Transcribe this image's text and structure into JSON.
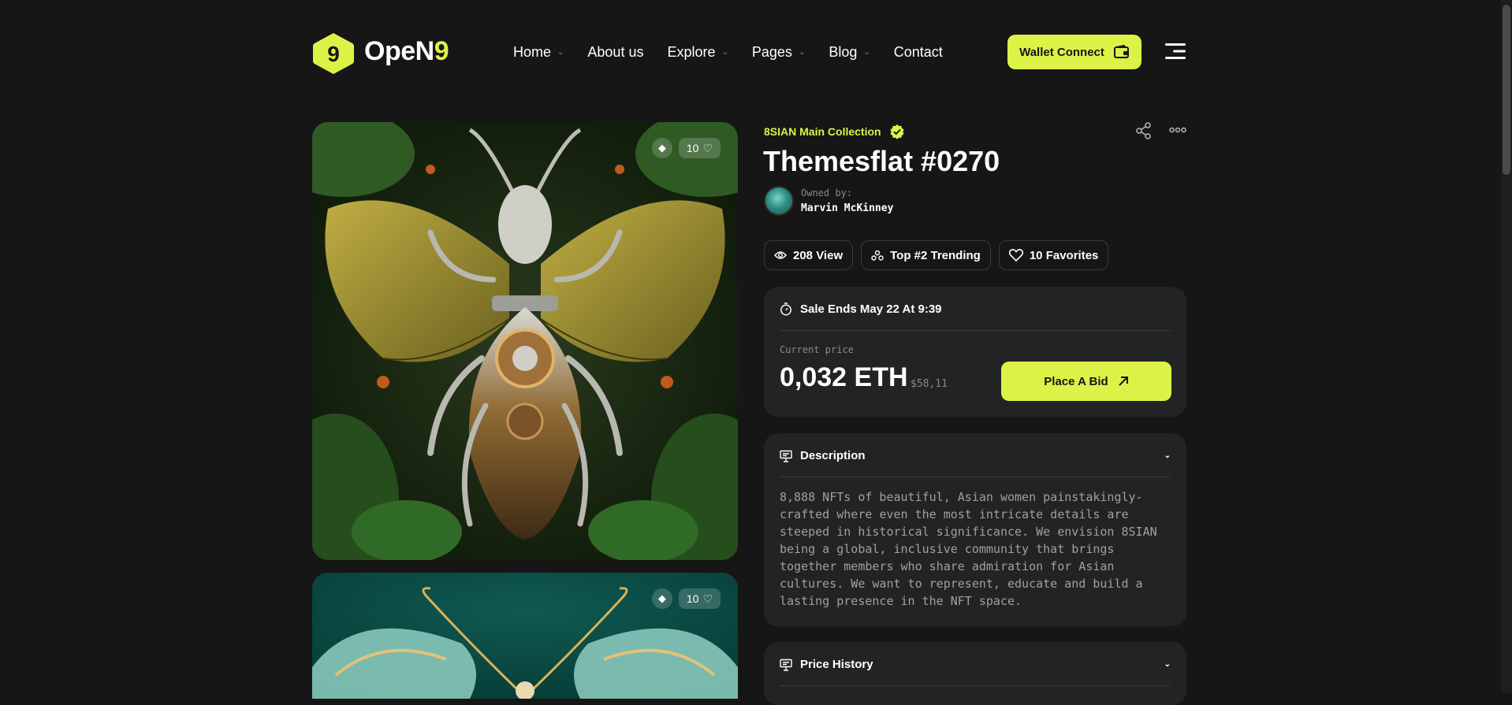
{
  "brand": {
    "name_main": "OpeN",
    "name_accent": "9",
    "logo_glyph": "9",
    "accent_color": "#DDF247"
  },
  "nav": [
    {
      "label": "Home",
      "has_dropdown": true
    },
    {
      "label": "About us",
      "has_dropdown": false
    },
    {
      "label": "Explore",
      "has_dropdown": true
    },
    {
      "label": "Pages",
      "has_dropdown": true
    },
    {
      "label": "Blog",
      "has_dropdown": true
    },
    {
      "label": "Contact",
      "has_dropdown": false
    }
  ],
  "header": {
    "wallet_label": "Wallet Connect",
    "wallet_icon": "wallet-icon",
    "menu_icon": "hamburger-menu-icon"
  },
  "cards": [
    {
      "likes": "10",
      "chain_icon": "ethereum-icon"
    },
    {
      "likes": "10",
      "chain_icon": "ethereum-icon"
    }
  ],
  "item": {
    "collection": "8SIAN Main Collection",
    "title": "Themesflat #0270",
    "owned_label": "Owned by:",
    "owner": "Marvin McKinney"
  },
  "stats": {
    "views": "208 View",
    "trending": "Top #2 Trending",
    "favorites": "10 Favorites"
  },
  "sale": {
    "ends": "Sale Ends May 22 At 9:39",
    "current_price_label": "Current price",
    "price": "0,032 ETH",
    "usd": "$58,11",
    "bid_label": "Place A Bid"
  },
  "description": {
    "heading": "Description",
    "text": "8,888 NFTs of beautiful, Asian women painstakingly-crafted where even the most intricate details are steeped in historical significance. We envision 8SIAN being a global, inclusive community that brings together members who share admiration for Asian cultures. We want to represent, educate and build a lasting presence in the NFT space."
  },
  "price_history": {
    "heading": "Price History"
  }
}
